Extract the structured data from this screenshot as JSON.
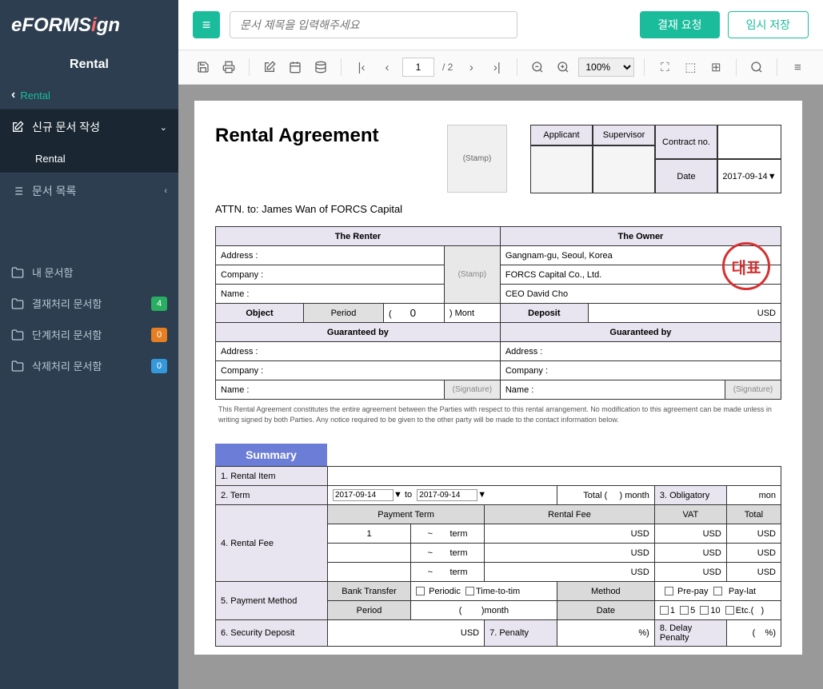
{
  "logo": {
    "pre": "eFORMS",
    "i": "i",
    "post": "gn"
  },
  "sidebar": {
    "title": "Rental",
    "breadcrumb": "Rental",
    "newDoc": "신규 문서 작성",
    "newDocSub": "Rental",
    "docList": "문서 목록",
    "folders": [
      {
        "label": "내 문서함"
      },
      {
        "label": "결재처리 문서함",
        "badge": "4",
        "bc": "bg"
      },
      {
        "label": "단계처리 문서함",
        "badge": "0",
        "bc": "bo"
      },
      {
        "label": "삭제처리 문서함",
        "badge": "0",
        "bc": "bb"
      }
    ]
  },
  "top": {
    "placeholder": "문서 제목을 입력해주세요",
    "approve": "결재 요청",
    "save": "임시 저장"
  },
  "toolbar": {
    "page": "1",
    "total": "/  2",
    "zoom": "100%"
  },
  "doc": {
    "title": "Rental Agreement",
    "stamp": "(Stamp)",
    "sig": {
      "applicant": "Applicant",
      "supervisor": "Supervisor",
      "contract": "Contract no.",
      "date": "Date",
      "dateVal": "2017-09-14"
    },
    "attn": "ATTN. to: James Wan of FORCS Capital",
    "renter": "The Renter",
    "owner": "The Owner",
    "addr": "Address :",
    "company": "Company :",
    "name": "Name :",
    "ownerAddr": "Gangnam-gu, Seoul, Korea",
    "ownerCo": "FORCS Capital Co., Ltd.",
    "ownerName": "CEO  David Cho",
    "object": "Object",
    "period": "Period",
    "periodNum": "0",
    "month": ") Mont",
    "deposit": "Deposit",
    "usd": "USD",
    "guar": "Guaranteed by",
    "sig2": "(Signature)",
    "stamp2": "(Stamp)",
    "legal": "This Rental Agreement constitutes the entire agreement between the Parties with respect to this rental arrangement.  No modification to this agreement can be made unless in writing signed by both Parties.  Any notice required to be given to the other party will be made to the contact information below.",
    "summary": "Summary",
    "s1": "1. Rental Item",
    "s2": "2. Term",
    "to": "to",
    "total": "Total (",
    "totalMon": ")  month",
    "s3": "3. Obligatory",
    "mon": "mon",
    "s4": "4. Rental Fee",
    "pt": "Payment Term",
    "rf": "Rental Fee",
    "vat": "VAT",
    "tot": "Total",
    "r1": "1",
    "tilde": "~",
    "term": "term",
    "s5": "5. Payment Method",
    "bank": "Bank Transfer",
    "periodic": "Periodic",
    "t2t": "Time-to-tim",
    "method": "Method",
    "prepay": "Pre-pay",
    "paylate": "Pay-lat",
    "period2": "Period",
    "lp": "(",
    "rp": ")month",
    "date": "Date",
    "c1": "1",
    "c5": "5",
    "c10": "10",
    "etc": "Etc.(",
    "etcR": ")",
    "s6": "6. Security Deposit",
    "s7": "7. Penalty",
    "pct": "%)",
    "s8": "8. Delay Penalty"
  }
}
